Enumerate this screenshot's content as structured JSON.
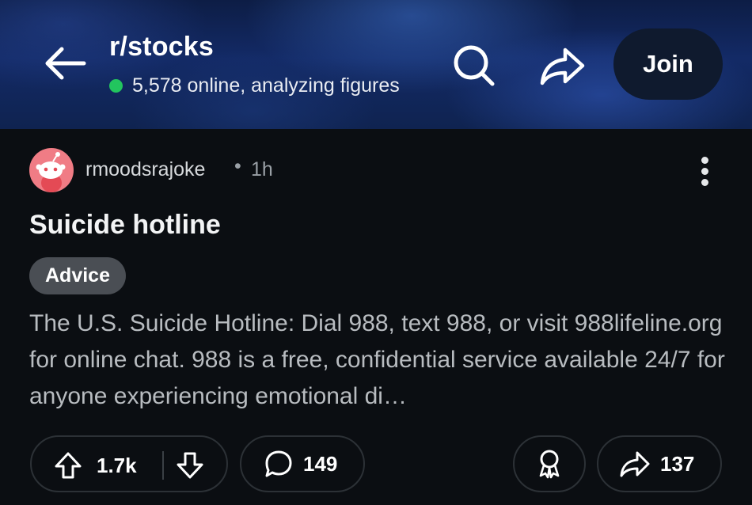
{
  "header": {
    "subreddit": "r/stocks",
    "online_text": "5,578 online, analyzing figures",
    "online_dot_color": "#22c55e",
    "join_label": "Join",
    "icons": [
      "back-arrow-icon",
      "search-icon",
      "share-icon"
    ]
  },
  "post": {
    "author": "rmoodsrajoke",
    "separator": "•",
    "time": "1h",
    "title": "Suicide hotline",
    "flair": "Advice",
    "body": "The U.S. Suicide Hotline: Dial 988, text 988, or visit 988lifeline.org for online chat. 988 is a free, confidential service available 24/7 for anyone experiencing emotional di…",
    "avatar_color": "#f07c85"
  },
  "actions": {
    "upvotes": "1.7k",
    "comments": "149",
    "shares": "137",
    "icons": [
      "upvote-icon",
      "downvote-icon",
      "comment-icon",
      "award-icon",
      "share-icon"
    ]
  }
}
